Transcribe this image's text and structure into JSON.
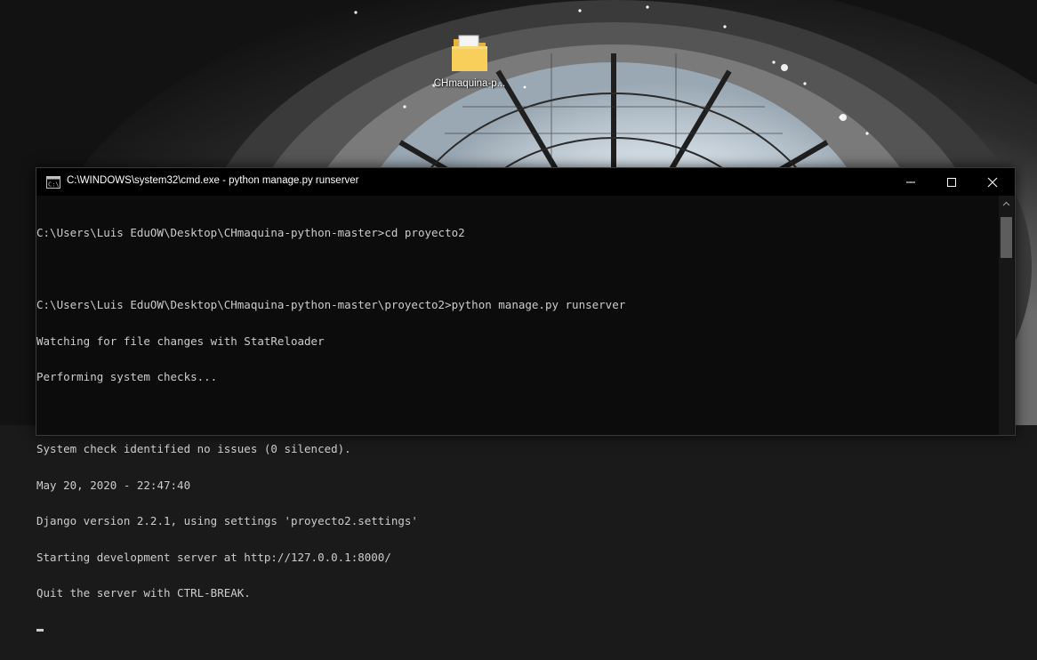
{
  "desktop": {
    "icons": [
      {
        "label": "CHmaquina-p...",
        "icon": "folder-icon"
      }
    ]
  },
  "window": {
    "title": "C:\\WINDOWS\\system32\\cmd.exe - python  manage.py runserver",
    "app_icon": "cmd-icon",
    "controls": {
      "minimize": "minimize-icon",
      "maximize": "maximize-icon",
      "close": "close-icon"
    }
  },
  "console": {
    "lines": [
      "C:\\Users\\Luis EduOW\\Desktop\\CHmaquina-python-master>cd proyecto2",
      "",
      "C:\\Users\\Luis EduOW\\Desktop\\CHmaquina-python-master\\proyecto2>python manage.py runserver",
      "Watching for file changes with StatReloader",
      "Performing system checks...",
      "",
      "System check identified no issues (0 silenced).",
      "May 20, 2020 - 22:47:40",
      "Django version 2.2.1, using settings 'proyecto2.settings'",
      "Starting development server at http://127.0.0.1:8000/",
      "Quit the server with CTRL-BREAK."
    ]
  },
  "colors": {
    "console_bg": "#0c0c0c",
    "console_text": "#cccccc",
    "titlebar_bg": "#000000"
  }
}
